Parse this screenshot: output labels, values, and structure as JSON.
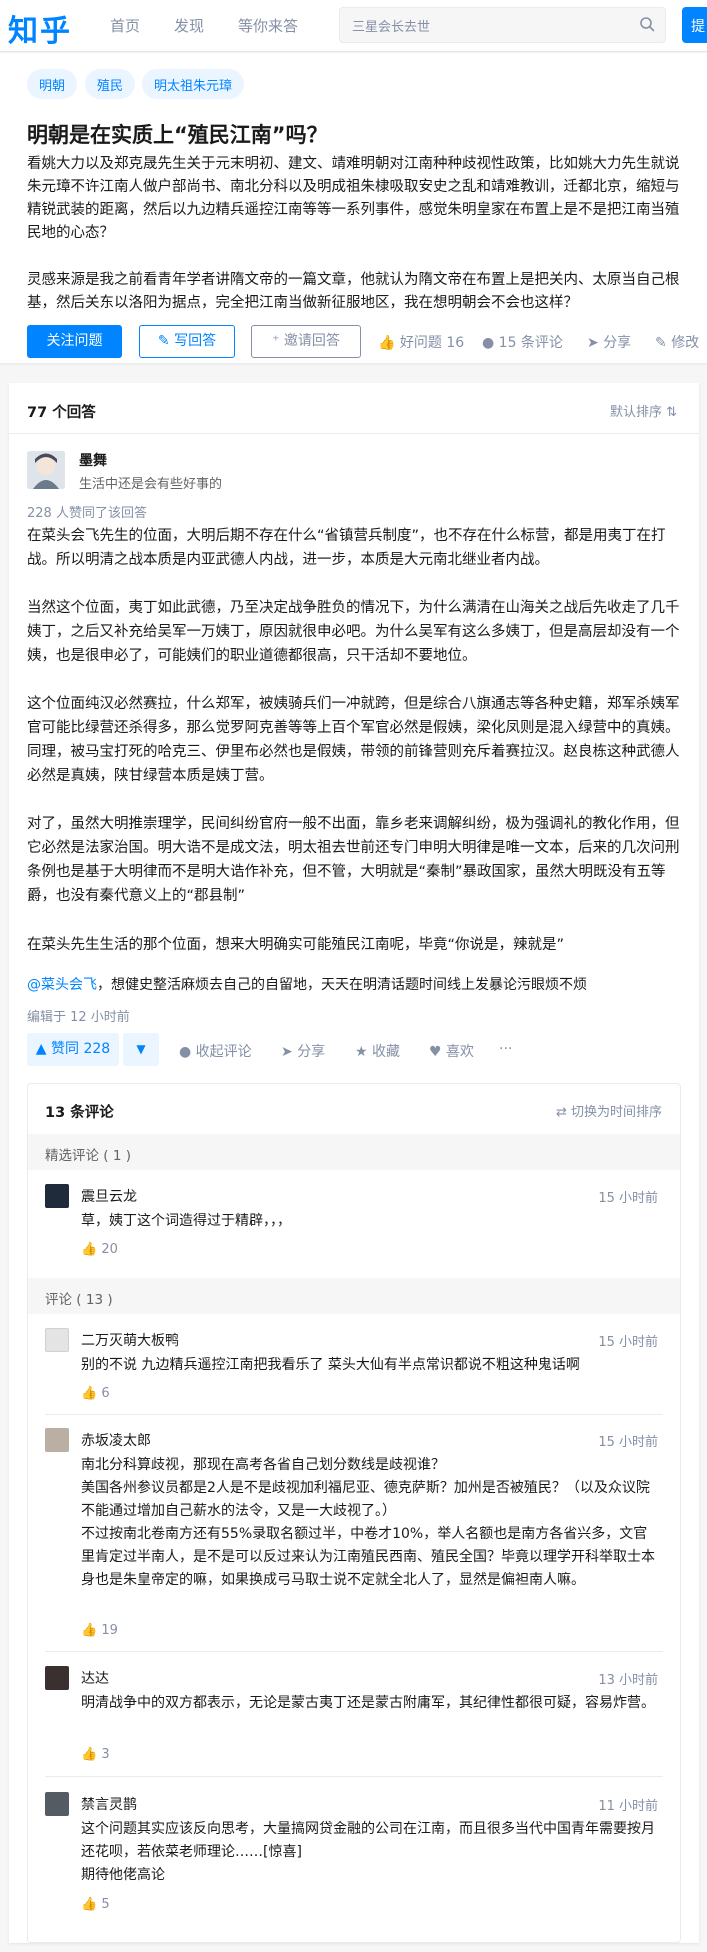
{
  "header": {
    "logo": "知乎",
    "nav": [
      "首页",
      "发现",
      "等你来答"
    ],
    "search_placeholder": "三星会长去世",
    "ask_label": "提"
  },
  "question": {
    "tags": [
      "明朝",
      "殖民",
      "明太祖朱元璋"
    ],
    "title": "明朝是在实质上“殖民江南”吗？",
    "desc1": "看姚大力以及郑克晟先生关于元末明初、建文、靖难明朝对江南种种歧视性政策，比如姚大力先生就说朱元璋不许江南人做户部尚书、南北分科以及明成祖朱棣吸取安史之乱和靖难教训，迁都北京，缩短与精锐武装的距离，然后以九边精兵遥控江南等等一系列事件，感觉朱明皇家在布置上是不是把江南当殖民地的心态？",
    "desc2": "灵感来源是我之前看青年学者讲隋文帝的一篇文章，他就认为隋文帝在布置上是把关内、太原当自己根基，然后关东以洛阳为据点，完全把江南当做新征服地区，我在想明朝会不会也这样？",
    "follow_label": "关注问题",
    "write_label": "写回答",
    "invite_label": "邀请回答",
    "good_question": "好问题 16",
    "comments": "15 条评论",
    "share": "分享",
    "edit": "修改"
  },
  "answers": {
    "count_label": "77 个回答",
    "sort_label": "默认排序",
    "author": "墨舞",
    "bio": "生活中还是会有些好事的",
    "voters": "228 人赞同了该回答",
    "paragraphs": [
      "在菜头会飞先生的位面，大明后期不存在什么“省镇营兵制度”，也不存在什么标营，都是用夷丁在打战。所以明清之战本质是内亚武德人内战，进一步，本质是大元南北继业者内战。",
      "当然这个位面，夷丁如此武德，乃至决定战争胜负的情况下，为什么满清在山海关之战后先收走了几千姨丁，之后又补充给吴军一万姨丁，原因就很申必吧。为什么吴军有这么多姨丁，但是高层却没有一个姨，也是很申必了，可能姨们的职业道德都很高，只干活却不要地位。",
      "这个位面纯汉必然赛拉，什么郑军，被姨骑兵们一冲就跨，但是综合八旗通志等各种史籍，郑军杀姨军官可能比绿营还杀得多，那么觉罗阿克善等等上百个军官必然是假姨，梁化凤则是混入绿营中的真姨。同理，被马宝打死的哈克三、伊里布必然也是假姨，带领的前锋营则充斥着赛拉汉。赵良栋这种武德人必然是真姨，陕甘绿营本质是姨丁营。",
      "对了，虽然大明推崇理学，民间纠纷官府一般不出面，靠乡老来调解纠纷，极为强调礼的教化作用，但它必然是法家治国。明大诰不是成文法，明太祖去世前还专门申明大明律是唯一文本，后来的几次问刑条例也是基于大明律而不是明大诰作补充，但不管，大明就是“秦制”暴政国家，虽然大明既没有五等爵，也没有秦代意义上的“郡县制”",
      "在菜头先生生活的那个位面，想来大明确实可能殖民江南呢，毕竟“你说是，辣就是”"
    ],
    "mention": "@菜头会飞",
    "mention_rest": "，想健史整活麻烦去自己的自留地，天天在明清话题时间线上发暴论污眼烦不烦",
    "edited": "编辑于 12 小时前",
    "vote_label": "▲ 赞同 228",
    "vote_down": "▼",
    "collapse_comments": "收起评论",
    "share": "分享",
    "favorite": "收藏",
    "like": "喜欢",
    "more": "···"
  },
  "comments": {
    "count_label": "13 条评论",
    "toggle_label": "切换为时间排序",
    "featured_label": "精选评论 ( 1 )",
    "all_label": "评论 ( 13 )",
    "featured": [
      {
        "name": "震旦云龙",
        "time": "15 小时前",
        "text": "草，姨丁这个词造得过于精辟，，，",
        "likes": "20"
      }
    ],
    "items": [
      {
        "name": "二万灭萌大板鸭",
        "time": "15 小时前",
        "text": "别的不说 九边精兵遥控江南把我看乐了 菜头大仙有半点常识都说不粗这种鬼话啊",
        "likes": "6"
      },
      {
        "name": "赤坂凌太郎",
        "time": "15 小时前",
        "text": "南北分科算歧视，那现在高考各省自己划分数线是歧视谁？\n美国各州参议员都是2人是不是歧视加利福尼亚、德克萨斯？加州是否被殖民？（以及众议院不能通过增加自己薪水的法令，又是一大歧视了。）\n不过按南北卷南方还有55%录取名额过半，中卷才10%，举人名额也是南方各省兴多，文官里肯定过半南人，是不是可以反过来认为江南殖民西南、殖民全国？毕竟以理学开科举取士本身也是朱皇帝定的嘛，如果换成弓马取士说不定就全北人了，显然是偏袒南人嘛。",
        "likes": "19"
      },
      {
        "name": "达达",
        "time": "13 小时前",
        "text": "明清战争中的双方都表示，无论是蒙古夷丁还是蒙古附庸军，其纪律性都很可疑，容易炸营。",
        "likes": "3"
      },
      {
        "name": "禁言灵鹊",
        "time": "11 小时前",
        "text": "这个问题其实应该反向思考，大量搞网贷金融的公司在江南，而且很多当代中国青年需要按月还花呗，若依菜老师理论……[惊喜]\n期待他佬高论",
        "likes": "5"
      }
    ]
  },
  "colors": {
    "accent": "#0084ff",
    "muted": "#8590a6",
    "tag_bg": "#ebf5ff"
  }
}
